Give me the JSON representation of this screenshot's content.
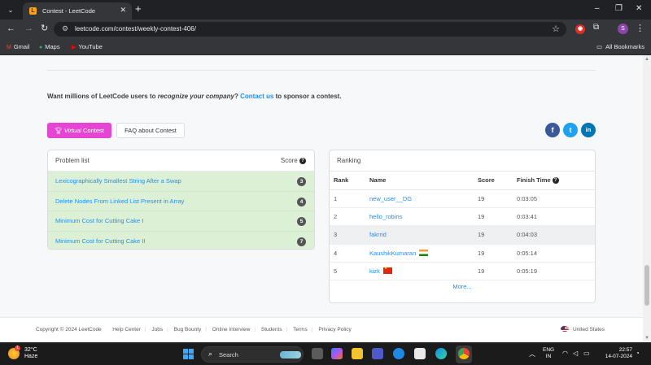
{
  "browser": {
    "tab_title": "Contest - LeetCode",
    "tab_favicon": "L",
    "url": "leetcode.com/contest/weekly-contest-406/",
    "profile_initial": "S",
    "bookmarks": [
      {
        "label": "Gmail",
        "icon": "gmail-icon"
      },
      {
        "label": "Maps",
        "icon": "maps-icon"
      },
      {
        "label": "YouTube",
        "icon": "youtube-icon"
      }
    ],
    "all_bookmarks": "All Bookmarks"
  },
  "sponsor": {
    "prefix": "Want millions of LeetCode users to ",
    "emphasis": "recognize your company",
    "middle": "? ",
    "link": "Contact us",
    "suffix": " to sponsor a contest."
  },
  "buttons": {
    "virtual_italic": "Virtual",
    "virtual_rest": " Contest",
    "faq": "FAQ about Contest"
  },
  "social": [
    {
      "name": "facebook",
      "glyph": "f",
      "color": "#3b5998"
    },
    {
      "name": "twitter",
      "glyph": "t",
      "color": "#1da1f2"
    },
    {
      "name": "linkedin",
      "glyph": "in",
      "color": "#0077b5"
    }
  ],
  "problems": {
    "header": "Problem list",
    "score_header": "Score",
    "items": [
      {
        "title": "Lexicographically Smallest String After a Swap",
        "score": "3"
      },
      {
        "title": "Delete Nodes From Linked List Present in Array",
        "score": "4"
      },
      {
        "title": "Minimum Cost for Cutting Cake I",
        "score": "5"
      },
      {
        "title": "Minimum Cost for Cutting Cake II",
        "score": "7"
      }
    ]
  },
  "ranking": {
    "header": "Ranking",
    "columns": [
      "Rank",
      "Name",
      "Score",
      "Finish Time"
    ],
    "rows": [
      {
        "rank": "1",
        "name": "new_user__DG",
        "score": "19",
        "time": "0:03:05",
        "flag": ""
      },
      {
        "rank": "2",
        "name": "hello_robins",
        "score": "19",
        "time": "0:03:41",
        "flag": ""
      },
      {
        "rank": "3",
        "name": "fakrrid",
        "score": "19",
        "time": "0:04:03",
        "flag": ""
      },
      {
        "rank": "4",
        "name": "KaushikKumaran",
        "score": "19",
        "time": "0:05:14",
        "flag": "in"
      },
      {
        "rank": "5",
        "name": "kizk",
        "score": "19",
        "time": "0:05:19",
        "flag": "cn"
      }
    ],
    "more": "More..."
  },
  "footer": {
    "copyright": "Copyright © 2024 LeetCode",
    "links": [
      "Help Center",
      "Jobs",
      "Bug Bounty",
      "Online Interview",
      "Students",
      "Terms",
      "Privacy Policy"
    ],
    "region": "United States"
  },
  "taskbar": {
    "temp": "32°C",
    "weather": "Haze",
    "weather_badge": "1",
    "search": "Search",
    "lang_1": "ENG",
    "lang_2": "IN",
    "time": "22:57",
    "date": "14-07-2024"
  }
}
